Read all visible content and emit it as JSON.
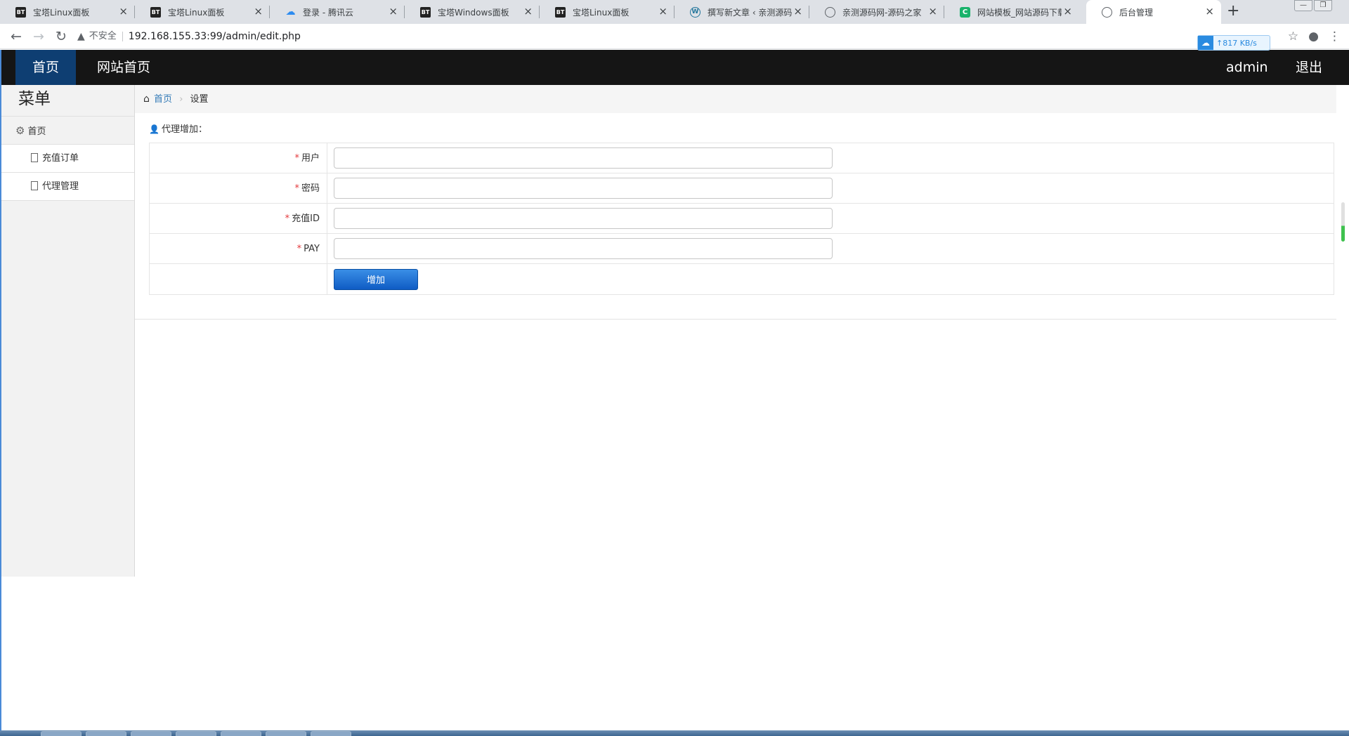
{
  "browser": {
    "tabs": [
      {
        "title": "宝塔Linux面板",
        "icon": "bt-icon"
      },
      {
        "title": "宝塔Linux面板",
        "icon": "bt-icon"
      },
      {
        "title": "登录 - 腾讯云",
        "icon": "cloud-icon"
      },
      {
        "title": "宝塔Windows面板",
        "icon": "bt-icon"
      },
      {
        "title": "宝塔Linux面板",
        "icon": "bt-icon"
      },
      {
        "title": "撰写新文章 ‹ 亲测源码网",
        "icon": "wordpress-icon"
      },
      {
        "title": "亲测源码网-源码之家",
        "icon": "globe-icon"
      },
      {
        "title": "网站模板_网站源码下载",
        "icon": "green-c-icon"
      },
      {
        "title": "后台管理",
        "icon": "globe-icon",
        "active": true
      }
    ],
    "bt_favicon_text": "BT",
    "wp_favicon_text": "W",
    "green_favicon_text": "C",
    "new_tab": "+",
    "security_label": "不安全",
    "url": "192.168.155.33:99/admin/edit.php",
    "speed": "817 KB/s"
  },
  "topnav": {
    "home": "首页",
    "site_home": "网站首页",
    "user": "admin",
    "logout": "退出"
  },
  "sidebar": {
    "title": "菜单",
    "group": "首页",
    "items": [
      {
        "label": "充值订单"
      },
      {
        "label": "代理管理"
      }
    ]
  },
  "breadcrumb": {
    "home": "首页",
    "current": "设置"
  },
  "form": {
    "title": "代理增加：",
    "required_mark": "*",
    "fields": [
      {
        "label": "用户",
        "value": ""
      },
      {
        "label": "密码",
        "value": ""
      },
      {
        "label": "充值ID",
        "value": ""
      },
      {
        "label": "PAY",
        "value": ""
      }
    ],
    "submit": "增加"
  },
  "colors": {
    "topnav_bg": "#151515",
    "topnav_active": "#0e3e72",
    "button": "#1565c8",
    "link": "#337ab7",
    "required": "#e4393c"
  }
}
